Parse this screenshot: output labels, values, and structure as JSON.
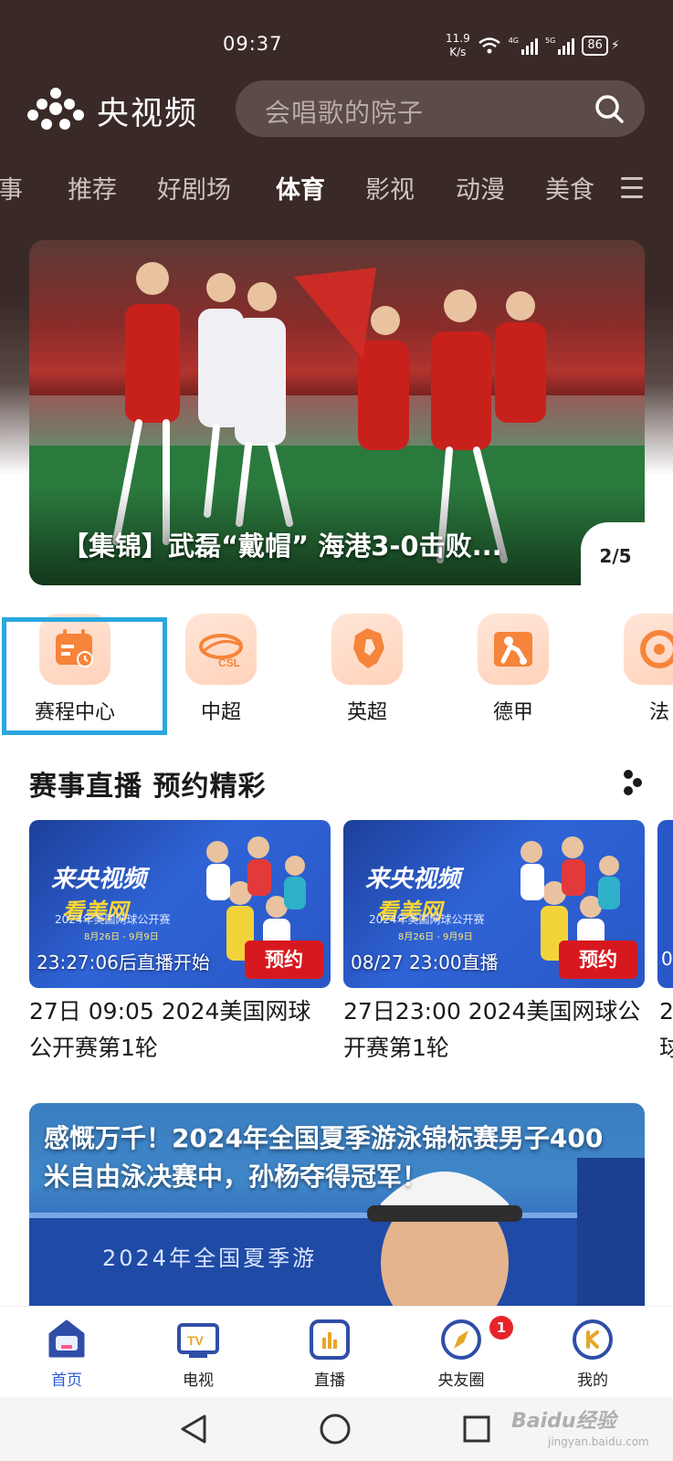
{
  "status": {
    "time": "09:37",
    "net_speed": "11.9",
    "net_unit": "K/s",
    "sig1": "4G",
    "sig2": "5G",
    "battery": "86"
  },
  "header": {
    "brand": "央视频",
    "search_placeholder": "会唱歌的院子"
  },
  "category_tabs": [
    "事",
    "推荐",
    "好剧场",
    "体育",
    "影视",
    "动漫",
    "美食"
  ],
  "active_tab": "体育",
  "banner": {
    "title": "【集锦】武磊“戴帽” 海港3-0击败...",
    "page": "2/5"
  },
  "sports": [
    {
      "label": "赛程中心",
      "icon": "calendar-clock-icon"
    },
    {
      "label": "中超",
      "icon": "csl-logo-icon"
    },
    {
      "label": "英超",
      "icon": "premier-league-lion-icon"
    },
    {
      "label": "德甲",
      "icon": "bundesliga-icon"
    },
    {
      "label": "法",
      "icon": "ligue1-icon"
    }
  ],
  "section": {
    "title": "赛事直播 预约精彩"
  },
  "live_cards": [
    {
      "status": "23:27:06后直播开始",
      "button": "预约",
      "title": "27日 09:05 2024美国网球公开赛第1轮",
      "poster_brand": "来央视频",
      "poster_subtitle": "看美网",
      "poster_event": "2024年美国网球公开赛",
      "poster_dates": "8月26日 - 9月9日"
    },
    {
      "status": "08/27 23:00直播",
      "button": "预约",
      "title": "27日23:00 2024美国网球公开赛第1轮",
      "poster_brand": "来央视频",
      "poster_subtitle": "看美网",
      "poster_event": "2024年美国网球公开赛",
      "poster_dates": "8月26日 - 9月9日"
    }
  ],
  "peek_card": {
    "status": "0",
    "title_1": "2",
    "title_2": "球"
  },
  "news": {
    "title": "感慨万千！2024年全国夏季游泳锦标赛男子400米自由泳决赛中，孙杨夺得冠军！",
    "board": "2024年全国夏季游"
  },
  "bottom_nav": [
    {
      "label": "首页",
      "icon": "home-icon",
      "active": true
    },
    {
      "label": "电视",
      "icon": "tv-icon",
      "active": false
    },
    {
      "label": "直播",
      "icon": "live-icon",
      "active": false
    },
    {
      "label": "央友圈",
      "icon": "compass-icon",
      "active": false,
      "badge": "1"
    },
    {
      "label": "我的",
      "icon": "profile-icon",
      "active": false
    }
  ],
  "watermark": {
    "text": "Baidu经验",
    "sub": "jingyan.baidu.com"
  },
  "colors": {
    "header_bg": "#3a2a27",
    "accent_blue": "#2a5bd7",
    "highlight": "#2aa7dd",
    "reserve_red": "#d7191f"
  }
}
